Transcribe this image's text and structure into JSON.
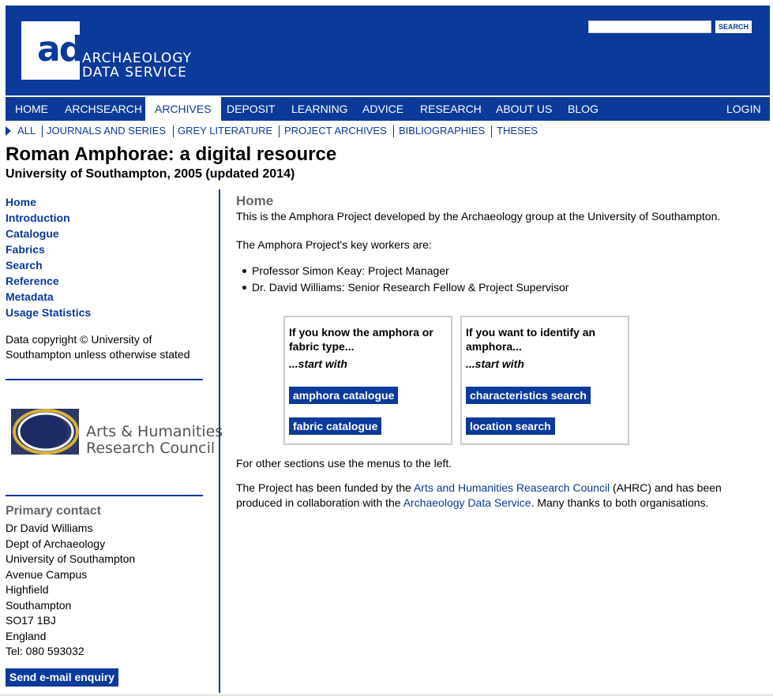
{
  "header": {
    "logo_mark": "ads",
    "logo_line1": "ARCHAEOLOGY",
    "logo_line2": "DATA SERVICE",
    "search_value": "",
    "search_button": "SEARCH"
  },
  "main_nav": {
    "items": [
      "HOME",
      "ARCHSEARCH",
      "ARCHIVES",
      "DEPOSIT",
      "LEARNING",
      "ADVICE",
      "RESEARCH",
      "ABOUT US",
      "BLOG"
    ],
    "active": "ARCHIVES",
    "login": "LOGIN"
  },
  "sub_nav": {
    "items": [
      "ALL",
      "JOURNALS AND SERIES",
      "GREY LITERATURE",
      "PROJECT ARCHIVES",
      "BIBLIOGRAPHIES",
      "THESES"
    ]
  },
  "page": {
    "title": "Roman Amphorae: a digital resource",
    "subtitle": "University of Southampton, 2005 (updated 2014)"
  },
  "sidebar": {
    "nav": [
      "Home",
      "Introduction",
      "Catalogue",
      "Fabrics",
      "Search",
      "Reference",
      "Metadata",
      "Usage Statistics"
    ],
    "copyright": "Data copyright © University of Southampton unless otherwise stated",
    "partner_logo_line1": "Arts & Humanities",
    "partner_logo_line2": "Research Council",
    "contact_heading": "Primary contact",
    "contact_lines": [
      "Dr David Williams",
      "Dept of Archaeology",
      "University of Southampton",
      "Avenue Campus",
      "Highfield",
      "Southampton",
      "SO17 1BJ",
      "England",
      "Tel: 080 593032"
    ],
    "email_button": "Send e-mail enquiry"
  },
  "content": {
    "heading": "Home",
    "intro": "This is the Amphora Project developed by the Archaeology group at the University of Southampton.",
    "workers_intro": "The Amphora Project's key workers are:",
    "workers": [
      "Professor Simon Keay: Project Manager",
      "Dr. David Williams: Senior Research Fellow & Project Supervisor"
    ],
    "box_left": {
      "title": "If you know the amphora or fabric type...",
      "start": "...start with",
      "buttons": [
        "amphora catalogue",
        "fabric catalogue"
      ]
    },
    "box_right": {
      "title": "If you want to identify an amphora...",
      "start": "...start with",
      "buttons": [
        "characteristics search",
        "location search"
      ]
    },
    "other_sections": "For other sections use the menus to the left.",
    "funded_pre": "The Project has been funded by the ",
    "funded_link1": "Arts and Humanities Reasearch Council",
    "funded_mid": " (AHRC) and has been produced in collaboration with the ",
    "funded_link2": "Archaeology Data Service",
    "funded_post": ". Many thanks to both organisations."
  },
  "colors": {
    "brand_blue": "#0b3a9a",
    "heading_grey": "#666666"
  }
}
